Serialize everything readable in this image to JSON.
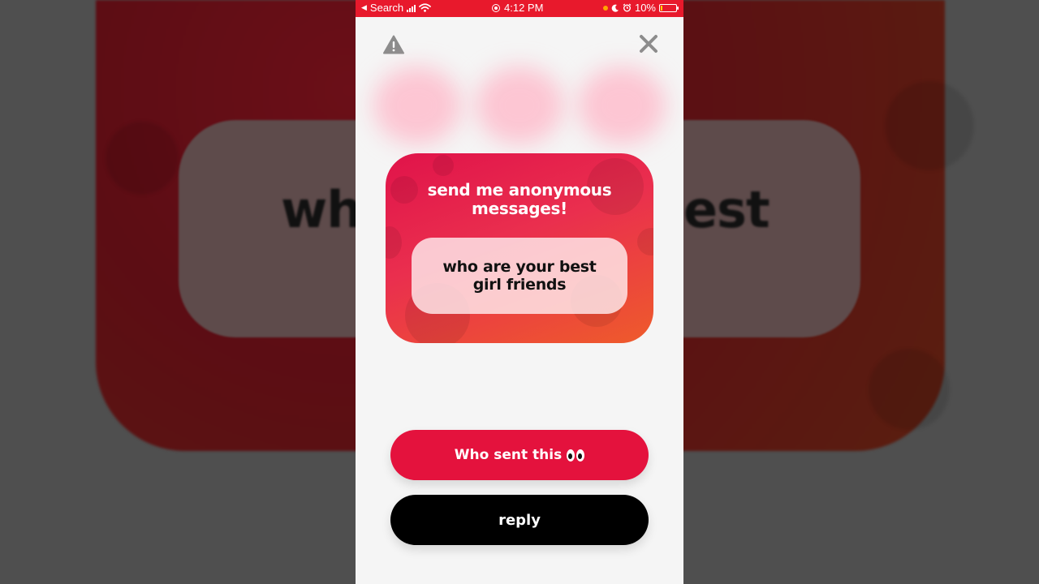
{
  "status_bar": {
    "back_label": "Search",
    "time": "4:12 PM",
    "battery": "10%",
    "battery_level": 0.1,
    "color": "#e8192c"
  },
  "background_text": {
    "left": "wh",
    "right": "est"
  },
  "header": {
    "report_icon": "warning-icon",
    "close_icon": "close-icon"
  },
  "card": {
    "title": "send me anonymous messages!",
    "question": "who are your best girl friends",
    "gradient": [
      "#e0134a",
      "#ee5b2b"
    ]
  },
  "actions": {
    "who_sent_label": "Who sent this",
    "who_sent_emoji": "eyes-icon",
    "who_sent_color": "#e4123d",
    "reply_label": "reply",
    "reply_color": "#000000"
  }
}
